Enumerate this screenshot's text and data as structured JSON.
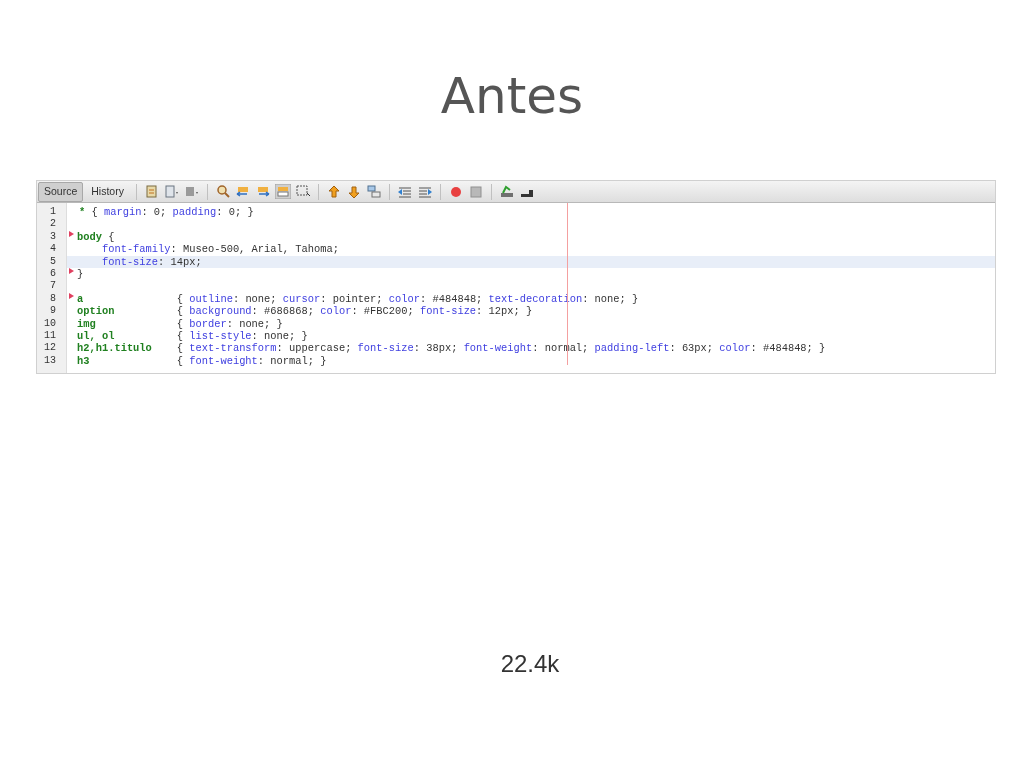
{
  "slide_title": "Antes",
  "editor": {
    "tabs": [
      {
        "label": "Source",
        "selected": true
      },
      {
        "label": "History",
        "selected": false
      }
    ],
    "lines": [
      {
        "number": "1",
        "kind": "rule",
        "selector": "*",
        "body": [
          {
            "text": "{ ",
            "kind": "plain"
          },
          {
            "text": "margin",
            "kind": "prop"
          },
          {
            "text": ": 0; ",
            "kind": "plain"
          },
          {
            "text": "padding",
            "kind": "prop"
          },
          {
            "text": ": 0; }",
            "kind": "plain"
          }
        ],
        "marked": false,
        "current": false
      },
      {
        "number": "2",
        "kind": "blank",
        "marked": false,
        "current": false
      },
      {
        "number": "3",
        "kind": "open",
        "selector": "body",
        "body": [
          {
            "text": " {",
            "kind": "plain"
          }
        ],
        "marked": true,
        "current": false
      },
      {
        "number": "4",
        "kind": "decl",
        "body": [
          {
            "text": "font-family",
            "kind": "prop"
          },
          {
            "text": ": Museo-500, Arial, Tahoma;",
            "kind": "plain"
          }
        ],
        "marked": false,
        "current": false
      },
      {
        "number": "5",
        "kind": "decl",
        "body": [
          {
            "text": "font-size",
            "kind": "prop"
          },
          {
            "text": ": 14px;",
            "kind": "plain"
          }
        ],
        "marked": false,
        "current": true
      },
      {
        "number": "6",
        "kind": "close",
        "body": [
          {
            "text": "}",
            "kind": "plain"
          }
        ],
        "marked": true,
        "current": false
      },
      {
        "number": "7",
        "kind": "blank",
        "marked": false,
        "current": false
      },
      {
        "number": "8",
        "kind": "column",
        "selector": "a",
        "body": [
          {
            "text": "{ ",
            "kind": "plain"
          },
          {
            "text": "outline",
            "kind": "prop"
          },
          {
            "text": ": none; ",
            "kind": "plain"
          },
          {
            "text": "cursor",
            "kind": "prop"
          },
          {
            "text": ": pointer; ",
            "kind": "plain"
          },
          {
            "text": "color",
            "kind": "prop"
          },
          {
            "text": ": #484848; ",
            "kind": "plain"
          },
          {
            "text": "text-decoration",
            "kind": "prop"
          },
          {
            "text": ": none; }",
            "kind": "plain"
          }
        ],
        "marked": true,
        "current": false
      },
      {
        "number": "9",
        "kind": "column",
        "selector": "option",
        "body": [
          {
            "text": "{ ",
            "kind": "plain"
          },
          {
            "text": "background",
            "kind": "prop"
          },
          {
            "text": ": #686868; ",
            "kind": "plain"
          },
          {
            "text": "color",
            "kind": "prop"
          },
          {
            "text": ": #FBC200; ",
            "kind": "plain"
          },
          {
            "text": "font-size",
            "kind": "prop"
          },
          {
            "text": ": 12px; }",
            "kind": "plain"
          }
        ],
        "marked": false,
        "current": false
      },
      {
        "number": "10",
        "kind": "column",
        "selector": "img",
        "body": [
          {
            "text": "{ ",
            "kind": "plain"
          },
          {
            "text": "border",
            "kind": "prop"
          },
          {
            "text": ": none; }",
            "kind": "plain"
          }
        ],
        "marked": false,
        "current": false
      },
      {
        "number": "11",
        "kind": "column",
        "selector": "ul, ol",
        "body": [
          {
            "text": "{ ",
            "kind": "plain"
          },
          {
            "text": "list-style",
            "kind": "prop"
          },
          {
            "text": ": none; }",
            "kind": "plain"
          }
        ],
        "marked": false,
        "current": false
      },
      {
        "number": "12",
        "kind": "column",
        "selector": "h2,h1.titulo",
        "body": [
          {
            "text": "{ ",
            "kind": "plain"
          },
          {
            "text": "text-transform",
            "kind": "prop"
          },
          {
            "text": ": uppercase; ",
            "kind": "plain"
          },
          {
            "text": "font-size",
            "kind": "prop"
          },
          {
            "text": ": 38px; ",
            "kind": "plain"
          },
          {
            "text": "font-weight",
            "kind": "prop"
          },
          {
            "text": ": normal; ",
            "kind": "plain"
          },
          {
            "text": "padding-left",
            "kind": "prop"
          },
          {
            "text": ": 63px; ",
            "kind": "plain"
          },
          {
            "text": "color",
            "kind": "prop"
          },
          {
            "text": ": #484848; }",
            "kind": "plain"
          }
        ],
        "marked": false,
        "current": false
      },
      {
        "number": "13",
        "kind": "column",
        "selector": "h3",
        "body": [
          {
            "text": "{ ",
            "kind": "plain"
          },
          {
            "text": "font-weight",
            "kind": "prop"
          },
          {
            "text": ": normal; }",
            "kind": "plain"
          }
        ],
        "marked": false,
        "current": false
      }
    ]
  },
  "footer": "22.4k"
}
